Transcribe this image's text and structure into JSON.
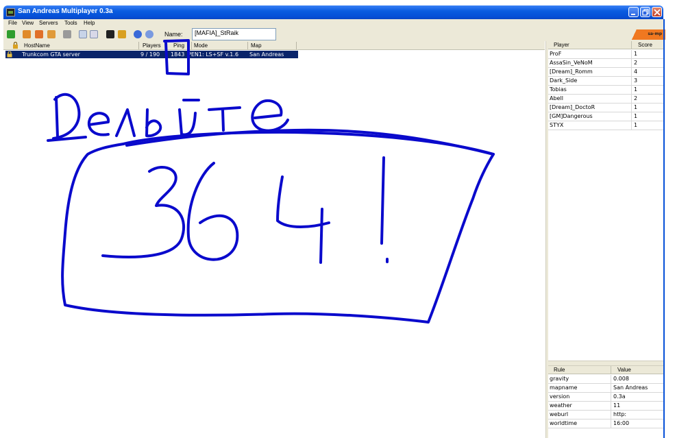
{
  "window": {
    "title": "San Andreas Multiplayer 0.3a",
    "accent": "#0a5ce0"
  },
  "menu": [
    "File",
    "View",
    "Servers",
    "Tools",
    "Help"
  ],
  "toolbar": {
    "name_label": "Name:",
    "name_value": "[MAFIA]_StRaik",
    "logo_text": "sa-mp"
  },
  "server_list": {
    "columns": [
      "HostName",
      "Players",
      "Ping",
      "Mode",
      "Map"
    ],
    "rows": [
      {
        "hostname": "Trunkcom GTA server",
        "players": "9 / 190",
        "ping": "1843",
        "mode": "PEN1: LS+SF v.1.6",
        "map": "San Andreas"
      }
    ],
    "selected_color": "#0a246a"
  },
  "players_panel": {
    "columns": [
      "Player",
      "Score"
    ],
    "rows": [
      {
        "name": "ProF",
        "score": "1"
      },
      {
        "name": "AssaSin_VeNoM",
        "score": "2"
      },
      {
        "name": "[Dream]_Romm",
        "score": "4"
      },
      {
        "name": "Dark_Side",
        "score": "3"
      },
      {
        "name": "Tobias",
        "score": "1"
      },
      {
        "name": "Abell",
        "score": "2"
      },
      {
        "name": "[Dream]_DoctoR",
        "score": "1"
      },
      {
        "name": "[GM]Dangerous",
        "score": "1"
      },
      {
        "name": "STYX",
        "score": "1"
      }
    ]
  },
  "rules_panel": {
    "columns": [
      "Rule",
      "Value"
    ],
    "rows": [
      {
        "rule": "gravity",
        "value": "0.008"
      },
      {
        "rule": "mapname",
        "value": "San Andreas"
      },
      {
        "rule": "version",
        "value": "0.3a"
      },
      {
        "rule": "weather",
        "value": "11"
      },
      {
        "rule": "weburl",
        "value": "http:"
      },
      {
        "rule": "worldtime",
        "value": "16:00"
      }
    ]
  },
  "annotation": {
    "text": "Деньте 364!",
    "color": "#0a0acc"
  }
}
